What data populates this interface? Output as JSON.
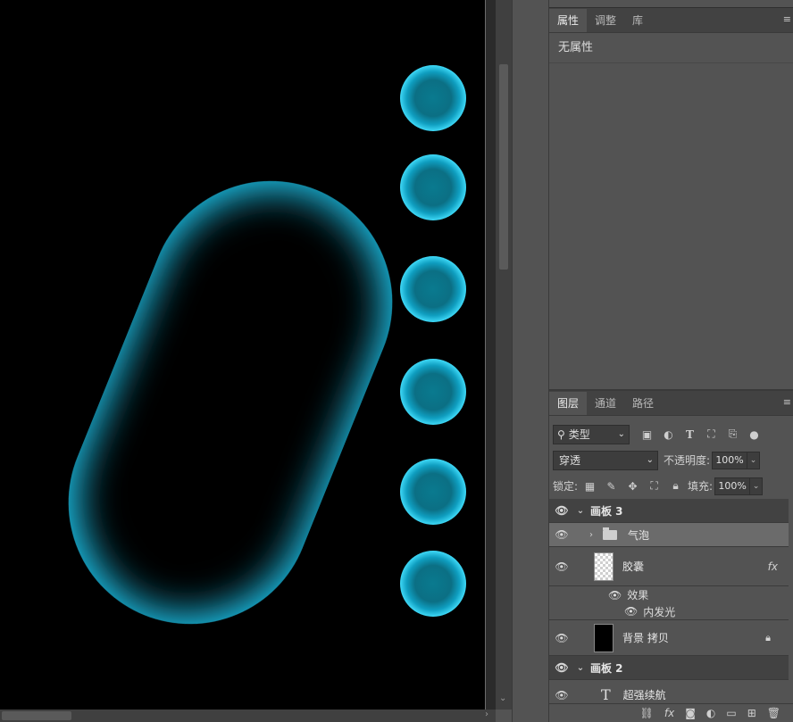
{
  "properties_panel": {
    "tabs": [
      "属性",
      "调整",
      "库"
    ],
    "active_tab": "属性",
    "empty_text": "无属性"
  },
  "layers_panel": {
    "tabs": [
      "图层",
      "通道",
      "路径"
    ],
    "active_tab": "图层",
    "filter_kind": "类型",
    "blend_mode": "穿透",
    "opacity_label": "不透明度:",
    "opacity_value": "100%",
    "lock_label": "锁定:",
    "fill_label": "填充:",
    "fill_value": "100%",
    "layers": {
      "artboard3": "画板 3",
      "bubbles": "气泡",
      "capsule": "胶囊",
      "effects": "效果",
      "inner_glow": "内发光",
      "bg_copy": "背景 拷贝",
      "artboard2": "画板 2",
      "text_layer": "超强续航"
    },
    "fx_badge": "fx",
    "text_icon": "T"
  },
  "colors": {
    "glow": "#1fc8f0",
    "bubble": "#0b8fa8",
    "canvas": "#000000",
    "panel_bg": "#535353"
  }
}
